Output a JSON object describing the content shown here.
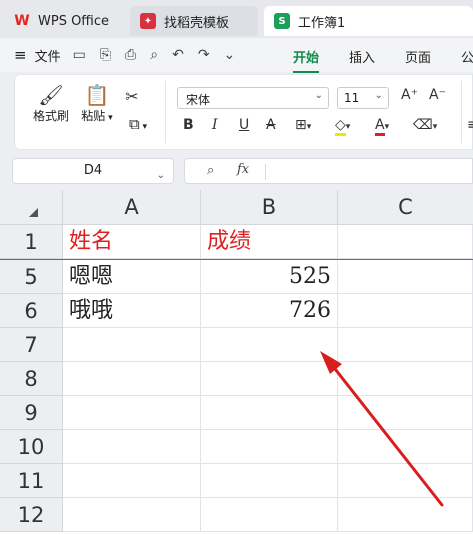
{
  "tabs": {
    "wps": "WPS Office",
    "template": "找稻壳模板",
    "sheet": "工作簿1"
  },
  "menu": {
    "file": "文件",
    "tabs": [
      "开始",
      "插入",
      "页面",
      "公"
    ]
  },
  "ribbon": {
    "format_painter": "格式刷",
    "paste": "粘贴",
    "font_name": "宋体",
    "font_size": "11"
  },
  "formula_bar": {
    "name_box": "D4",
    "fx": "fx",
    "formula": ""
  },
  "sheet": {
    "columns": [
      "A",
      "B",
      "C"
    ],
    "rows": [
      {
        "num": "1",
        "a": "姓名",
        "b": "成绩"
      },
      {
        "num": "5",
        "a": "嗯嗯",
        "b": "525"
      },
      {
        "num": "6",
        "a": "哦哦",
        "b": "726"
      },
      {
        "num": "7",
        "a": "",
        "b": ""
      },
      {
        "num": "8",
        "a": "",
        "b": ""
      },
      {
        "num": "9",
        "a": "",
        "b": ""
      },
      {
        "num": "10",
        "a": "",
        "b": ""
      },
      {
        "num": "11",
        "a": "",
        "b": ""
      },
      {
        "num": "12",
        "a": "",
        "b": ""
      }
    ]
  },
  "colors": {
    "accent": "#128a4c",
    "header_text": "#e02020",
    "annotation_arrow": "#d91e1e"
  }
}
